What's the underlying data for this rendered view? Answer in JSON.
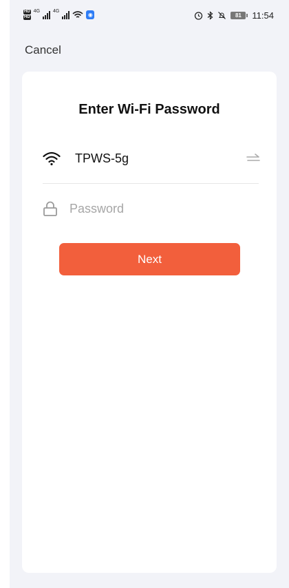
{
  "status_bar": {
    "time": "11:54",
    "battery": "81",
    "hd1": "HD",
    "hd2": "HD",
    "net1": "4G",
    "net2": "4G"
  },
  "header": {
    "cancel_label": "Cancel"
  },
  "card": {
    "title": "Enter Wi-Fi Password",
    "wifi_name": "TPWS-5g",
    "password_placeholder": "Password",
    "password_value": "",
    "next_label": "Next"
  },
  "colors": {
    "accent": "#f25f3c",
    "background": "#f2f3f8"
  },
  "icons": {
    "wifi": "wifi-icon",
    "swap": "swap-icon",
    "lock": "lock-icon"
  }
}
